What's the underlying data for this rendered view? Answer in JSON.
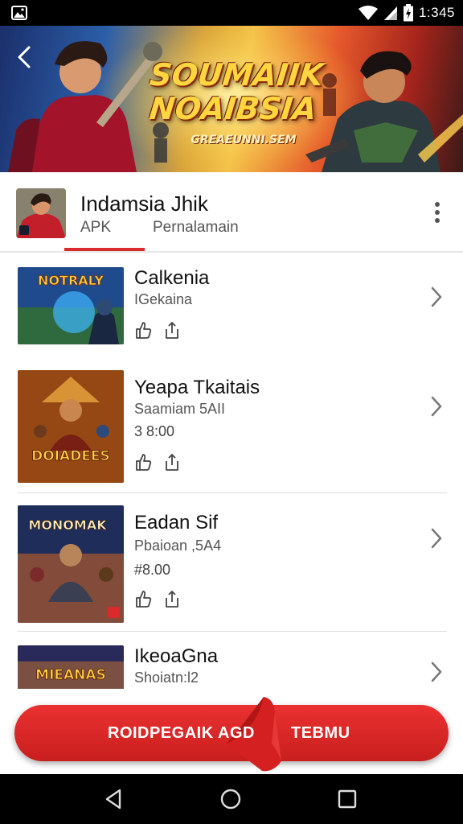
{
  "status_bar": {
    "time": "1:345"
  },
  "banner": {
    "title_line1": "SOUMAIIK",
    "title_line2": "NOAIBSIA",
    "subtitle": "GREAEUNNI.SEM"
  },
  "app": {
    "name": "Indamsia Jhik",
    "tabs": [
      "APK",
      "Pernalamain"
    ],
    "active_tab": "APK"
  },
  "items": [
    {
      "title": "Calkenia",
      "subtitle": "IGekaina",
      "price": ""
    },
    {
      "title": "Yeapa Tkaitais",
      "subtitle": "Saamiam 5AII",
      "price": "3 8:00"
    },
    {
      "title": "Eadan Sif",
      "subtitle": "Pbaioan ,5A4",
      "price": "#8.00"
    },
    {
      "title": "IkeoaGna",
      "subtitle": "Shoiatn:l2",
      "price": ""
    }
  ],
  "thumbs": [
    {
      "text": "NOTRALY"
    },
    {
      "text": "DOIADEES"
    },
    {
      "text": "MONOMAK"
    },
    {
      "text": "MIEANAS"
    }
  ],
  "cta": {
    "left": "ROIDPEGAIK AGD",
    "right": "TEBMU"
  },
  "colors": {
    "accent": "#d92b2b",
    "cta": "#e02828"
  }
}
